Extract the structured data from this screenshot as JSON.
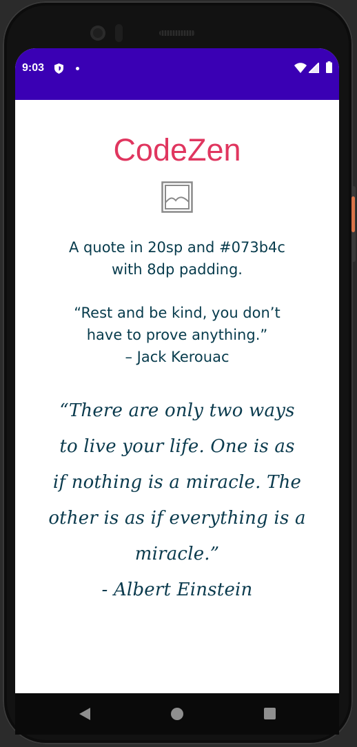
{
  "status_bar": {
    "time": "9:03",
    "icons": [
      "shield-icon",
      "notification-dot-icon",
      "wifi-icon",
      "signal-icon",
      "battery-icon"
    ],
    "background": "#3a00b4"
  },
  "app": {
    "title": "CodeZen",
    "title_color": "#e0365f",
    "image_icon": "image-placeholder-icon"
  },
  "quotes": {
    "intro_line1": "A quote in 20sp and #073b4c",
    "intro_line2": "with 8dp padding.",
    "kerouac_line1": "“Rest and be kind, you don’t",
    "kerouac_line2": "have to prove anything.”",
    "kerouac_author": "– Jack Kerouac",
    "einstein_line1": "“There are only two ways",
    "einstein_line2": "to live your life. One is as",
    "einstein_line3": "if nothing is a miracle. The",
    "einstein_line4": "other is as if everything is a",
    "einstein_line5": "miracle.”",
    "einstein_author": "- Albert Einstein",
    "text_color": "#073b4c"
  },
  "nav_bar": {
    "icons": [
      "back-icon",
      "home-icon",
      "recents-icon"
    ]
  }
}
